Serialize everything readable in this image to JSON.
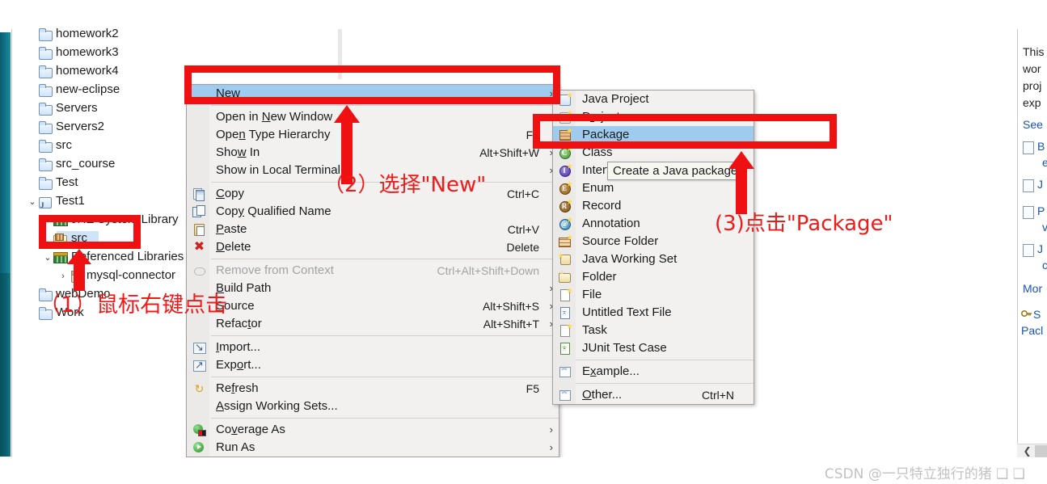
{
  "tree": {
    "items": [
      {
        "label": "homework2",
        "icon": "folder-icon",
        "indent": 0,
        "twisty": ""
      },
      {
        "label": "homework3",
        "icon": "folder-icon",
        "indent": 0,
        "twisty": ""
      },
      {
        "label": "homework4",
        "icon": "folder-icon",
        "indent": 0,
        "twisty": ""
      },
      {
        "label": "new-eclipse",
        "icon": "folder-icon",
        "indent": 0,
        "twisty": ""
      },
      {
        "label": "Servers",
        "icon": "folder-icon",
        "indent": 0,
        "twisty": ""
      },
      {
        "label": "Servers2",
        "icon": "folder-icon",
        "indent": 0,
        "twisty": ""
      },
      {
        "label": "src",
        "icon": "folder-icon",
        "indent": 0,
        "twisty": ""
      },
      {
        "label": "src_course",
        "icon": "folder-icon",
        "indent": 0,
        "twisty": ""
      },
      {
        "label": "Test",
        "icon": "folder-icon",
        "indent": 0,
        "twisty": ""
      },
      {
        "label": "Test1",
        "icon": "java-project-icon",
        "indent": 0,
        "twisty": "v"
      },
      {
        "label": "JRE System Library",
        "icon": "library-icon",
        "indent": 1,
        "twisty": ">"
      },
      {
        "label": "src",
        "icon": "source-folder-icon",
        "indent": 1,
        "twisty": ""
      },
      {
        "label": "Referenced Libraries",
        "icon": "library-icon",
        "indent": 1,
        "twisty": "v"
      },
      {
        "label": "mysql-connector",
        "icon": "jar-icon",
        "indent": 2,
        "twisty": ">"
      },
      {
        "label": "webDemo",
        "icon": "folder-icon",
        "indent": 0,
        "twisty": ""
      },
      {
        "label": "Work",
        "icon": "folder-icon",
        "indent": 0,
        "twisty": ""
      }
    ],
    "selected_label": "src"
  },
  "context_menu": {
    "items": [
      {
        "label": "New",
        "accel": "N",
        "key": "",
        "submenu": true,
        "selected": true,
        "icon": "",
        "disabled": false
      },
      {
        "sep": true
      },
      {
        "label": "Open in New Window",
        "accel": "N",
        "key": "",
        "submenu": false,
        "icon": "",
        "disabled": false
      },
      {
        "label": "Open Type Hierarchy",
        "accel": "n",
        "key": "F4",
        "submenu": false,
        "icon": "",
        "disabled": false
      },
      {
        "label": "Show In",
        "accel": "w",
        "key": "Alt+Shift+W",
        "submenu": true,
        "icon": "",
        "disabled": false
      },
      {
        "label": "Show in Local Terminal",
        "accel": "",
        "key": "",
        "submenu": true,
        "icon": "",
        "disabled": false
      },
      {
        "sep": true
      },
      {
        "label": "Copy",
        "accel": "C",
        "key": "Ctrl+C",
        "submenu": false,
        "icon": "copy-icon",
        "disabled": false
      },
      {
        "label": "Copy Qualified Name",
        "accel": "y",
        "key": "",
        "submenu": false,
        "icon": "copy-qualified-icon",
        "disabled": false
      },
      {
        "label": "Paste",
        "accel": "P",
        "key": "Ctrl+V",
        "submenu": false,
        "icon": "paste-icon",
        "disabled": false
      },
      {
        "label": "Delete",
        "accel": "D",
        "key": "Delete",
        "submenu": false,
        "icon": "delete-icon",
        "disabled": false
      },
      {
        "sep": true
      },
      {
        "label": "Remove from Context",
        "accel": "",
        "key": "Ctrl+Alt+Shift+Down",
        "submenu": false,
        "icon": "remove-context-icon",
        "disabled": true
      },
      {
        "label": "Build Path",
        "accel": "B",
        "key": "",
        "submenu": true,
        "icon": "",
        "disabled": false
      },
      {
        "label": "Source",
        "accel": "S",
        "key": "Alt+Shift+S",
        "submenu": true,
        "icon": "",
        "disabled": false
      },
      {
        "label": "Refactor",
        "accel": "t",
        "key": "Alt+Shift+T",
        "submenu": true,
        "icon": "",
        "disabled": false
      },
      {
        "sep": true
      },
      {
        "label": "Import...",
        "accel": "I",
        "key": "",
        "submenu": false,
        "icon": "import-icon",
        "disabled": false
      },
      {
        "label": "Export...",
        "accel": "o",
        "key": "",
        "submenu": false,
        "icon": "export-icon",
        "disabled": false
      },
      {
        "sep": true
      },
      {
        "label": "Refresh",
        "accel": "f",
        "key": "F5",
        "submenu": false,
        "icon": "refresh-icon",
        "disabled": false
      },
      {
        "label": "Assign Working Sets...",
        "accel": "A",
        "key": "",
        "submenu": false,
        "icon": "",
        "disabled": false
      },
      {
        "sep": true
      },
      {
        "label": "Coverage As",
        "accel": "v",
        "key": "",
        "submenu": true,
        "icon": "coverage-icon",
        "disabled": false
      },
      {
        "label": "Run As",
        "accel": "",
        "key": "",
        "submenu": true,
        "icon": "run-icon",
        "disabled": false
      }
    ]
  },
  "submenu": {
    "items": [
      {
        "label": "Java Project",
        "accel": "",
        "key": "",
        "icon": "java-project-icon",
        "selected": false
      },
      {
        "label": "Project...",
        "accel": "r",
        "key": "",
        "icon": "project-icon",
        "selected": false
      },
      {
        "label": "Package",
        "accel": "",
        "key": "",
        "icon": "package-icon",
        "selected": true
      },
      {
        "label": "Class",
        "accel": "",
        "key": "",
        "icon": "class-icon",
        "selected": false
      },
      {
        "label": "Interface",
        "accel": "",
        "key": "",
        "icon": "interface-icon",
        "selected": false
      },
      {
        "label": "Enum",
        "accel": "",
        "key": "",
        "icon": "enum-icon",
        "selected": false
      },
      {
        "label": "Record",
        "accel": "",
        "key": "",
        "icon": "record-icon",
        "selected": false
      },
      {
        "label": "Annotation",
        "accel": "",
        "key": "",
        "icon": "annotation-icon",
        "selected": false
      },
      {
        "label": "Source Folder",
        "accel": "",
        "key": "",
        "icon": "source-folder-icon",
        "selected": false
      },
      {
        "label": "Java Working Set",
        "accel": "",
        "key": "",
        "icon": "java-working-set-icon",
        "selected": false
      },
      {
        "label": "Folder",
        "accel": "",
        "key": "",
        "icon": "folder-icon",
        "selected": false
      },
      {
        "label": "File",
        "accel": "",
        "key": "",
        "icon": "file-icon",
        "selected": false
      },
      {
        "label": "Untitled Text File",
        "accel": "",
        "key": "",
        "icon": "text-file-icon",
        "selected": false
      },
      {
        "label": "Task",
        "accel": "",
        "key": "",
        "icon": "task-icon",
        "selected": false
      },
      {
        "label": "JUnit Test Case",
        "accel": "",
        "key": "",
        "icon": "junit-icon",
        "selected": false
      },
      {
        "sep": true
      },
      {
        "label": "Example...",
        "accel": "x",
        "key": "",
        "icon": "wizard-icon",
        "selected": false
      },
      {
        "sep": true
      },
      {
        "label": "Other...",
        "accel": "O",
        "key": "Ctrl+N",
        "icon": "wizard-icon",
        "selected": false
      }
    ]
  },
  "tooltip": {
    "text": "Create a Java package"
  },
  "annotations": [
    {
      "id": "step1",
      "text": "（1）鼠标右键点击"
    },
    {
      "id": "step2",
      "text": "（2）选择\"New\""
    },
    {
      "id": "step3",
      "text": "(3)点击\"Package\""
    }
  ],
  "help_panel": {
    "paragraph": [
      "This",
      "wor",
      "proj",
      "exp"
    ],
    "see_also": "See",
    "links": [
      {
        "line1": "B",
        "line2": "e"
      },
      {
        "line1": "J",
        "line2": ""
      },
      {
        "line1": "P",
        "line2": "v"
      },
      {
        "line1": "J",
        "line2": "c"
      }
    ],
    "more": "Mor",
    "footer_line1": "S",
    "footer_line2": "Pacl"
  },
  "watermark": {
    "text": "CSDN @一只特立独行的猪 ❑ ❑"
  },
  "colors": {
    "selection": "#9fcbee",
    "annotation_red": "#ef1111",
    "menu_bg": "#f2f1f0",
    "link_blue": "#1a53b0"
  }
}
